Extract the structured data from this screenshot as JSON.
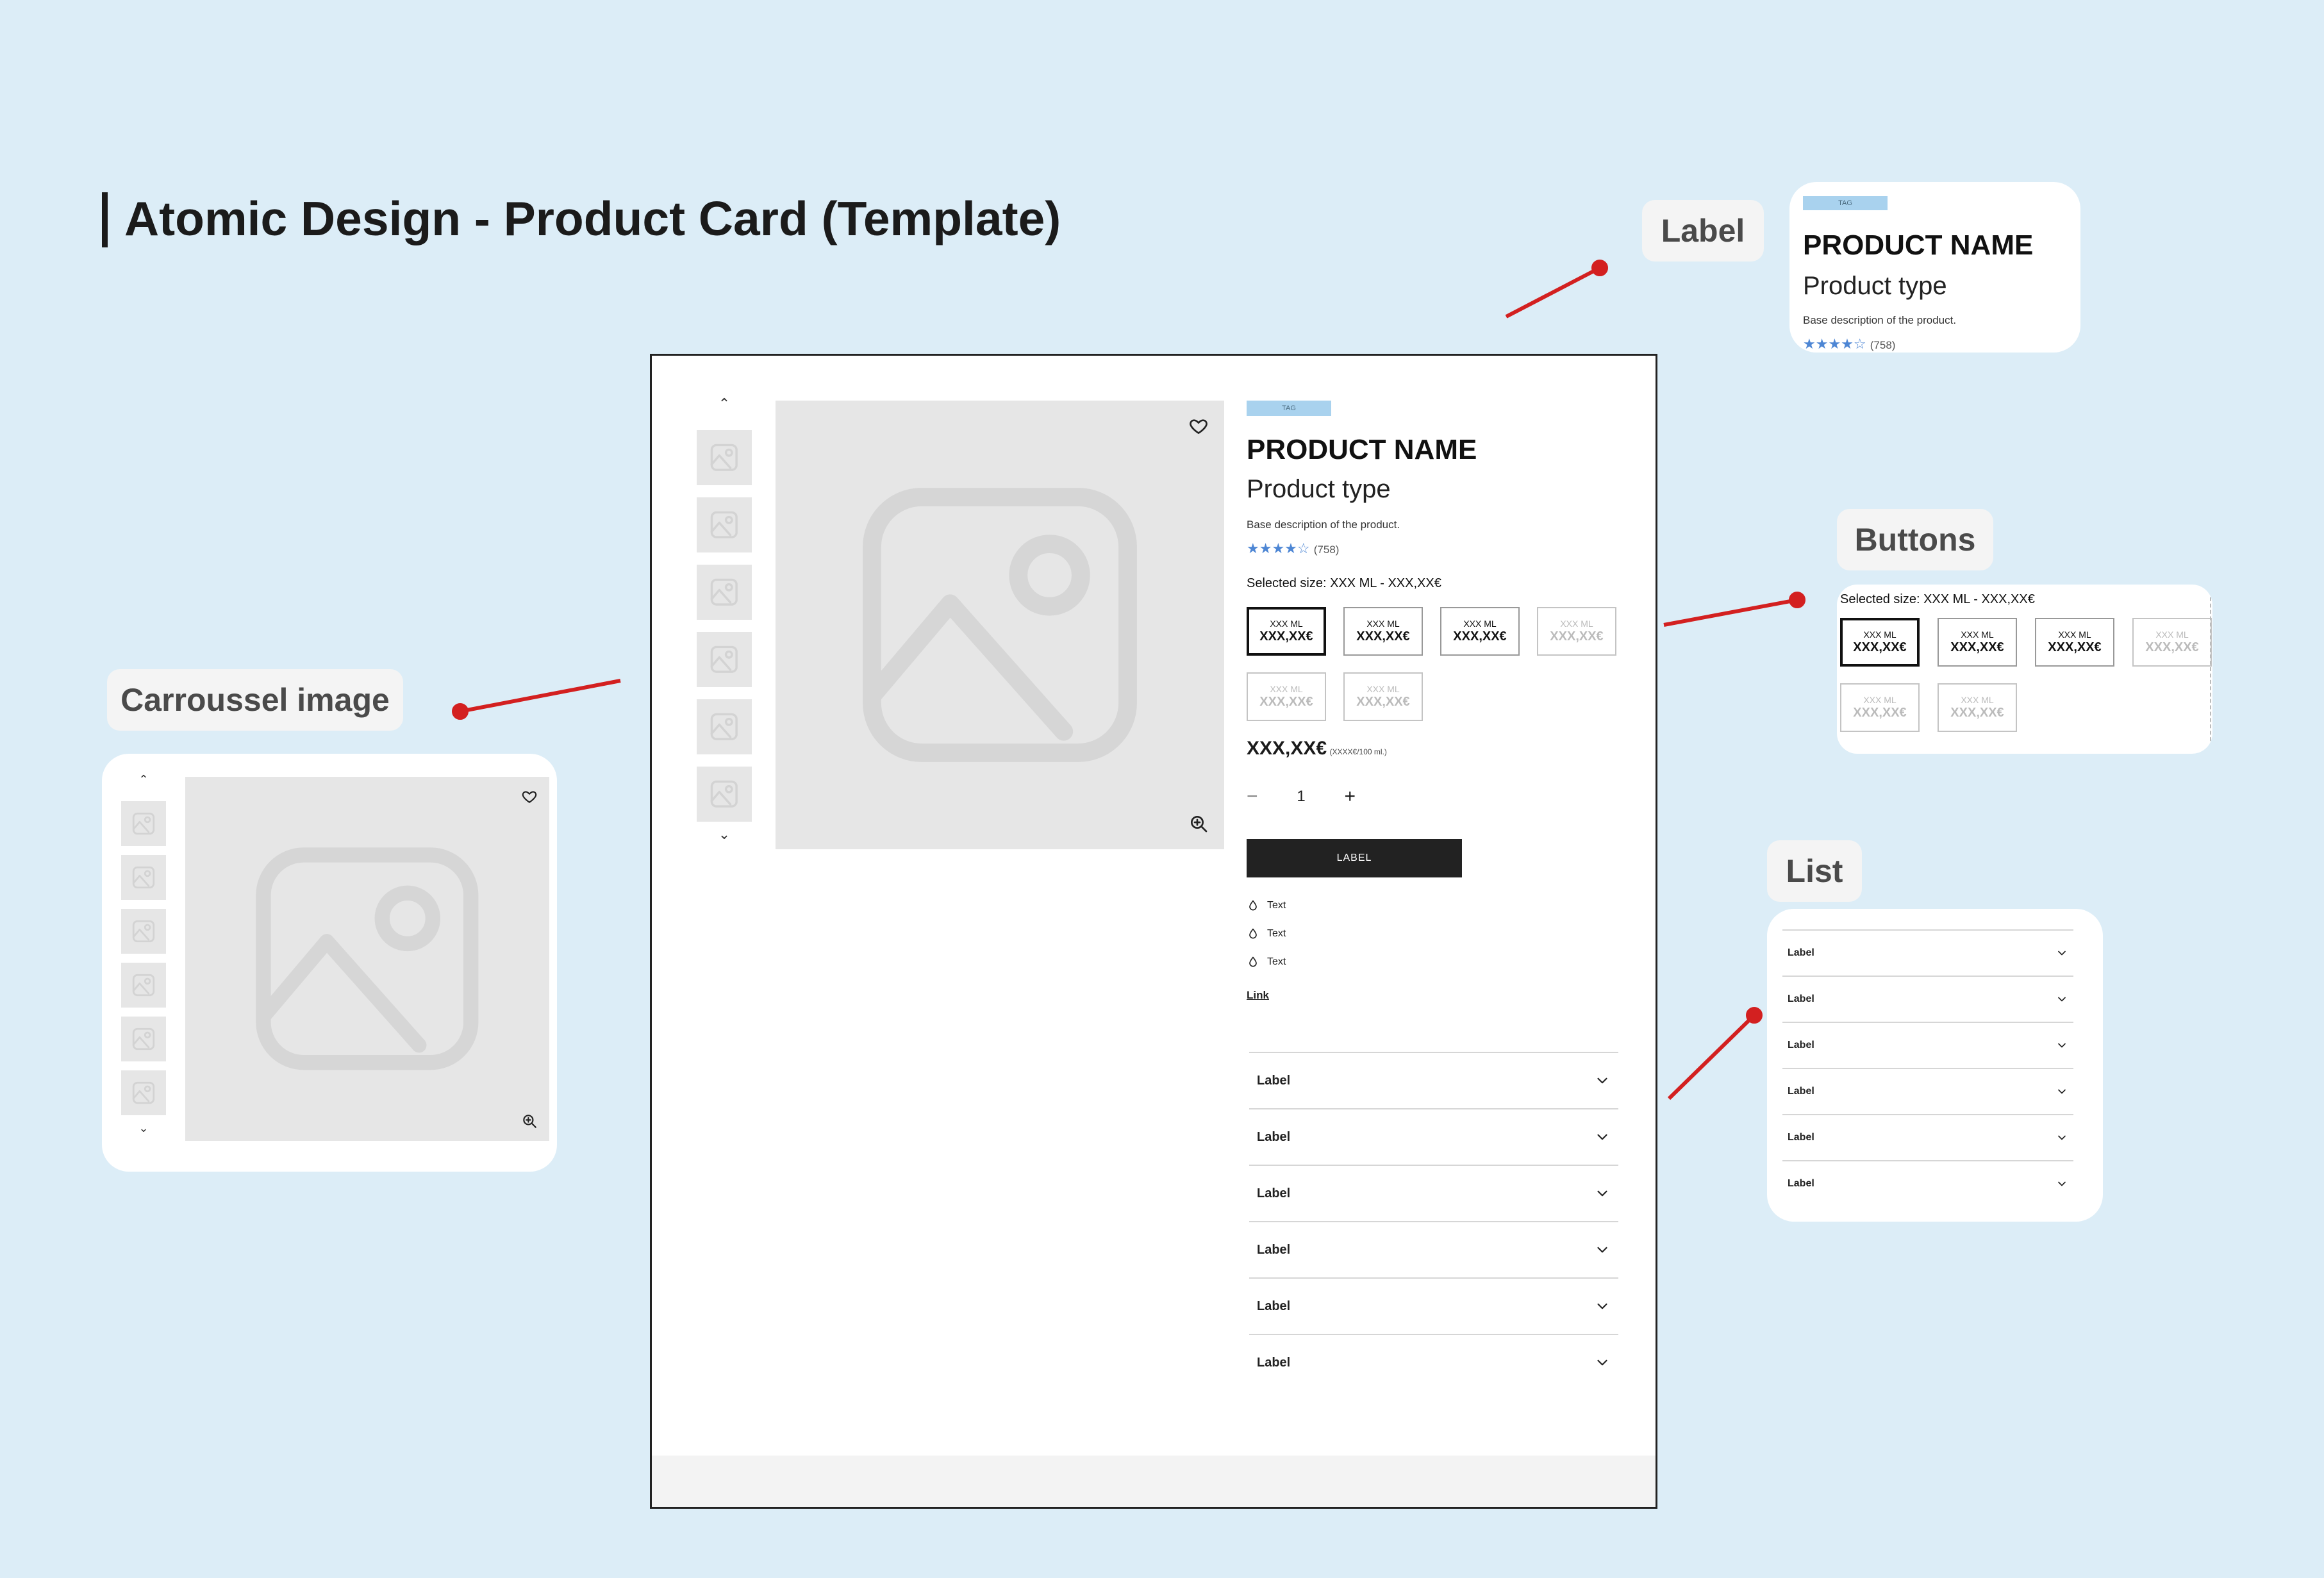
{
  "page": {
    "title": "Atomic Design - Product Card (Template)"
  },
  "callouts": {
    "label": "Label",
    "buttons": "Buttons",
    "list": "List",
    "carrousel": "Carroussel image"
  },
  "product": {
    "tag": "TAG",
    "name": "PRODUCT NAME",
    "type": "Product type",
    "description": "Base description of the product.",
    "stars": "★★★★☆",
    "rating_value": 4,
    "reviews": "(758)",
    "selected_size": "Selected size: XXX ML - XXX,XX€",
    "sizes": [
      {
        "ml": "XXX ML",
        "price": "XXX,XX€",
        "state": "selected"
      },
      {
        "ml": "XXX ML",
        "price": "XXX,XX€",
        "state": "available"
      },
      {
        "ml": "XXX ML",
        "price": "XXX,XX€",
        "state": "available"
      },
      {
        "ml": "XXX ML",
        "price": "XXX,XX€",
        "state": "disabled"
      },
      {
        "ml": "XXX ML",
        "price": "XXX,XX€",
        "state": "disabled"
      },
      {
        "ml": "XXX ML",
        "price": "XXX,XX€",
        "state": "disabled"
      }
    ],
    "price": "XXX,XX€",
    "unit_price": "(XXXX€/100 ml.)",
    "quantity": "1",
    "qty_minus": "−",
    "qty_plus": "+",
    "cta": "LABEL",
    "features": [
      "Text",
      "Text",
      "Text"
    ],
    "link": "Link",
    "carousel_up": "⌃",
    "carousel_down": "⌄"
  },
  "accordion": {
    "items": [
      "Label",
      "Label",
      "Label",
      "Label",
      "Label",
      "Label"
    ]
  },
  "icons": {
    "favorite": "heart-icon",
    "zoom": "zoom-in-icon",
    "feature": "drop-icon",
    "expand": "chevron-down-icon",
    "placeholder": "image-placeholder-icon"
  },
  "colors": {
    "background": "#dcedf7",
    "tag": "#a9d2ee",
    "stars": "#4d86d4",
    "connector": "#d32020",
    "cta": "#222222"
  }
}
